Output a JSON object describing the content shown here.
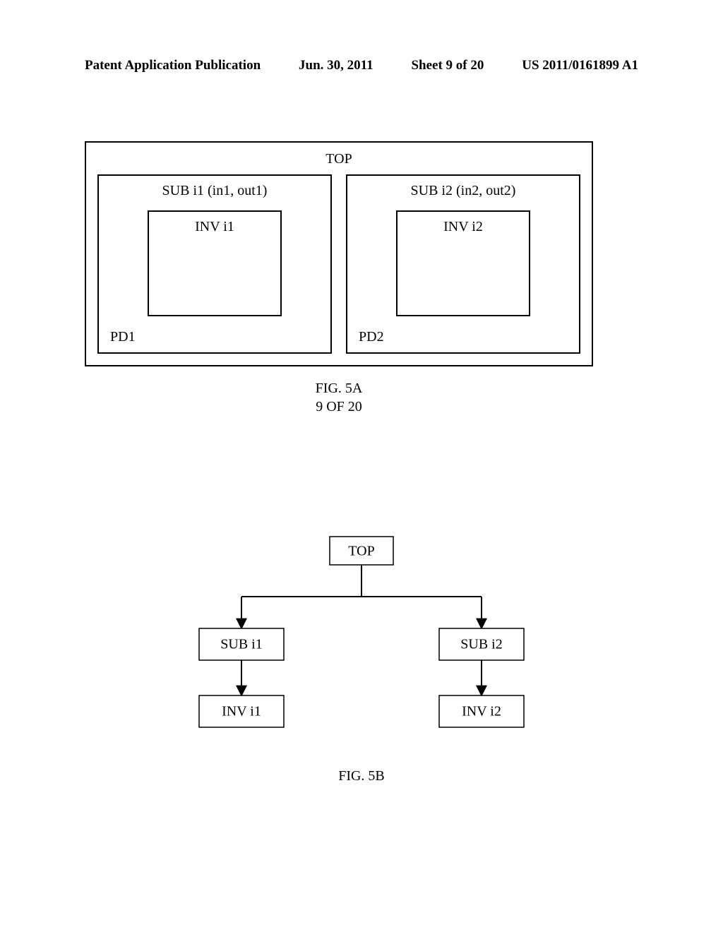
{
  "header": {
    "left": "Patent Application Publication",
    "center_left": "Jun. 30, 2011",
    "center_right": "Sheet 9 of 20",
    "right": "US 2011/0161899 A1"
  },
  "fig5a": {
    "top_label": "TOP",
    "subs": [
      {
        "label": "SUB i1 (in1, out1)",
        "inv": "INV i1",
        "pd": "PD1"
      },
      {
        "label": "SUB i2 (in2, out2)",
        "inv": "INV i2",
        "pd": "PD2"
      }
    ],
    "caption_line1": "FIG. 5A",
    "caption_line2": "9 OF 20"
  },
  "fig5b": {
    "nodes": {
      "top": "TOP",
      "sub1": "SUB i1",
      "sub2": "SUB i2",
      "inv1": "INV i1",
      "inv2": "INV i2"
    },
    "caption": "FIG. 5B"
  }
}
